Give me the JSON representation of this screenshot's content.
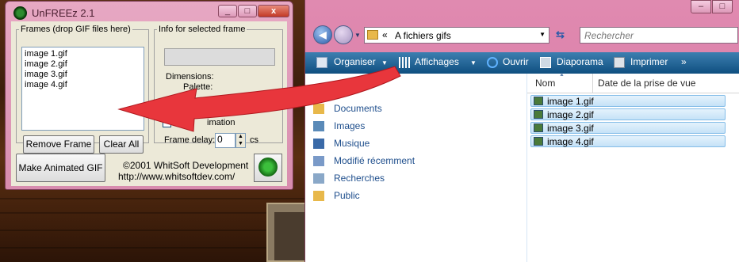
{
  "unfreez": {
    "title": "UnFREEz 2.1",
    "frames_group_label": "Frames (drop GIF files here)",
    "frames": [
      "image 1.gif",
      "image 2.gif",
      "image 3.gif",
      "image 4.gif"
    ],
    "remove_frame": "Remove Frame",
    "clear_all": "Clear All",
    "info_group_label": "Info for selected frame",
    "dimensions_label": "Dimensions:",
    "palette_label": "Palette:",
    "loop_partial": "L",
    "animation_partial": "imation",
    "frame_delay_label": "Frame delay:",
    "frame_delay_value": "0",
    "frame_delay_unit": "cs",
    "make_button": "Make Animated GIF",
    "copyright": "©2001 WhitSoft Development",
    "website": "http://www.whitsoftdev.com/",
    "caption_buttons": {
      "minimize": "_",
      "maximize": "□",
      "close": "x"
    }
  },
  "explorer": {
    "address_chevron": "«",
    "address_path": "A fichiers gifs",
    "search_placeholder": "Rechercher",
    "toolbar": {
      "organize": "Organiser",
      "views": "Affichages",
      "open": "Ouvrir",
      "slideshow": "Diaporama",
      "print": "Imprimer",
      "more": "»"
    },
    "nav_items": [
      "Documents",
      "Images",
      "Musique",
      "Modifié récemment",
      "Recherches",
      "Public"
    ],
    "columns": {
      "name": "Nom",
      "date": "Date de la prise de vue"
    },
    "files": [
      "image 1.gif",
      "image 2.gif",
      "image 3.gif",
      "image 4.gif"
    ]
  },
  "colors": {
    "window_frame": "#d88cae",
    "command_bar": "#1a5a8c",
    "arrow": "#e8363c",
    "selection": "#c5e2f7"
  }
}
